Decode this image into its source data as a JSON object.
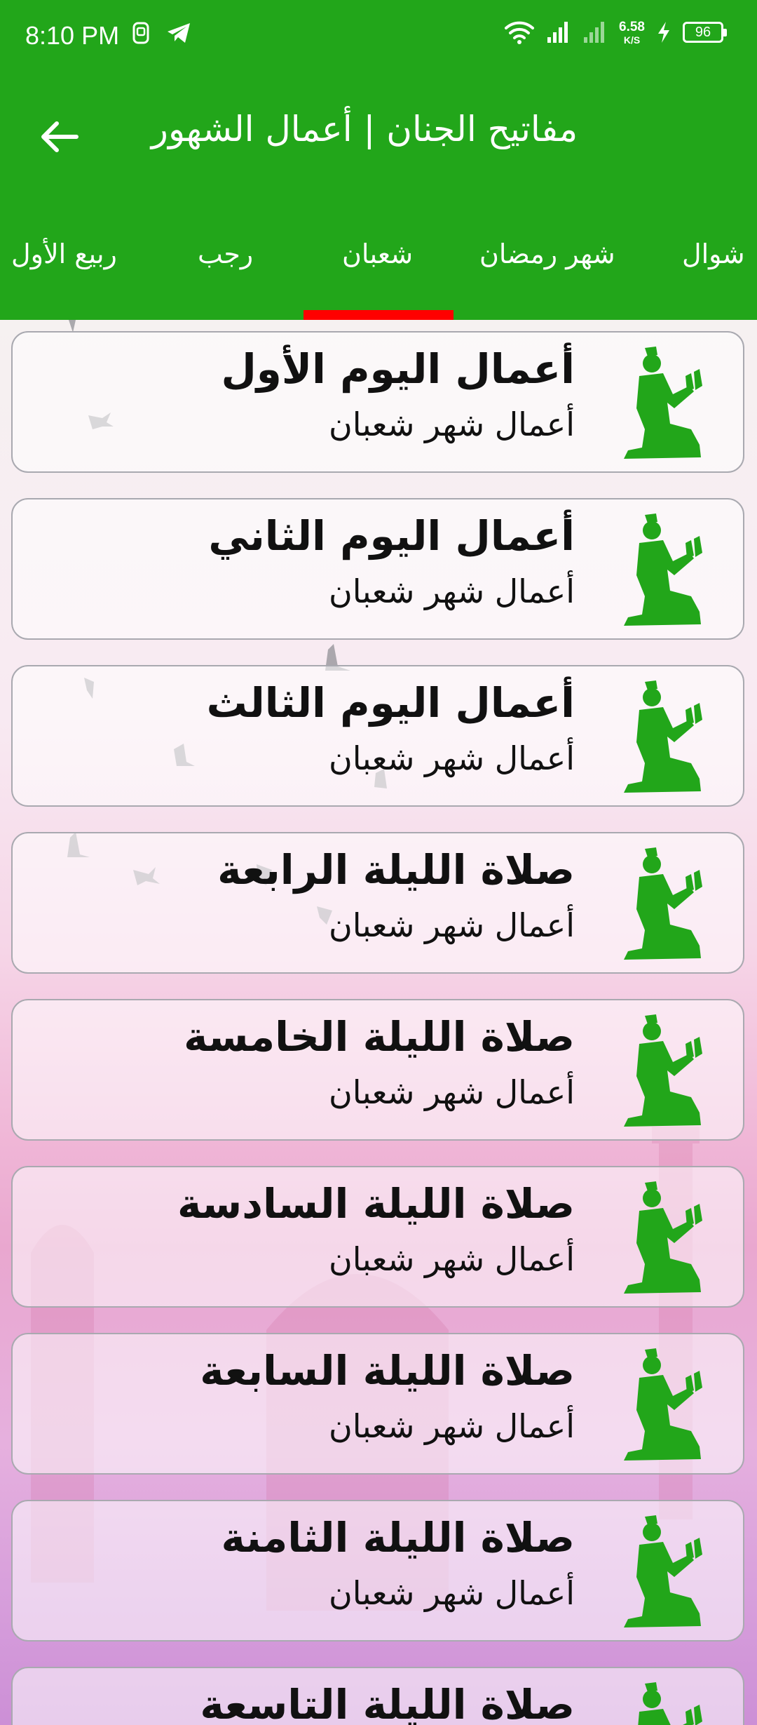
{
  "status_bar": {
    "time": "8:10 PM",
    "net_speed_value": "6.58",
    "net_speed_unit": "K/S",
    "battery": "96",
    "icons": [
      "sim-icon",
      "telegram-icon",
      "wifi-icon",
      "signal-icon",
      "signal-weak-icon",
      "charging-icon",
      "battery-icon"
    ]
  },
  "app_bar": {
    "title": "مفاتيح الجنان | أعمال الشهور",
    "back_icon": "arrow-left-icon"
  },
  "tabs": [
    {
      "label": "شوال"
    },
    {
      "label": "شهر رمضان"
    },
    {
      "label": "شعبان",
      "selected": true
    },
    {
      "label": "رجب"
    },
    {
      "label": "ربيع الأول"
    }
  ],
  "colors": {
    "primary": "#22a61a",
    "indicator": "#ff0000",
    "icon": "#22a61a"
  },
  "list": [
    {
      "title": "أعمال اليوم الأول",
      "subtitle": "أعمال شهر شعبان"
    },
    {
      "title": "أعمال اليوم الثاني",
      "subtitle": "أعمال شهر شعبان"
    },
    {
      "title": "أعمال اليوم الثالث",
      "subtitle": "أعمال شهر شعبان"
    },
    {
      "title": "صلاة الليلة الرابعة",
      "subtitle": "أعمال شهر شعبان"
    },
    {
      "title": "صلاة الليلة الخامسة",
      "subtitle": "أعمال شهر شعبان"
    },
    {
      "title": "صلاة الليلة السادسة",
      "subtitle": "أعمال شهر شعبان"
    },
    {
      "title": "صلاة الليلة السابعة",
      "subtitle": "أعمال شهر شعبان"
    },
    {
      "title": "صلاة الليلة الثامنة",
      "subtitle": "أعمال شهر شعبان"
    },
    {
      "title": "صلاة الليلة التاسعة",
      "subtitle": ""
    }
  ],
  "list_icon": "praying-man-icon"
}
